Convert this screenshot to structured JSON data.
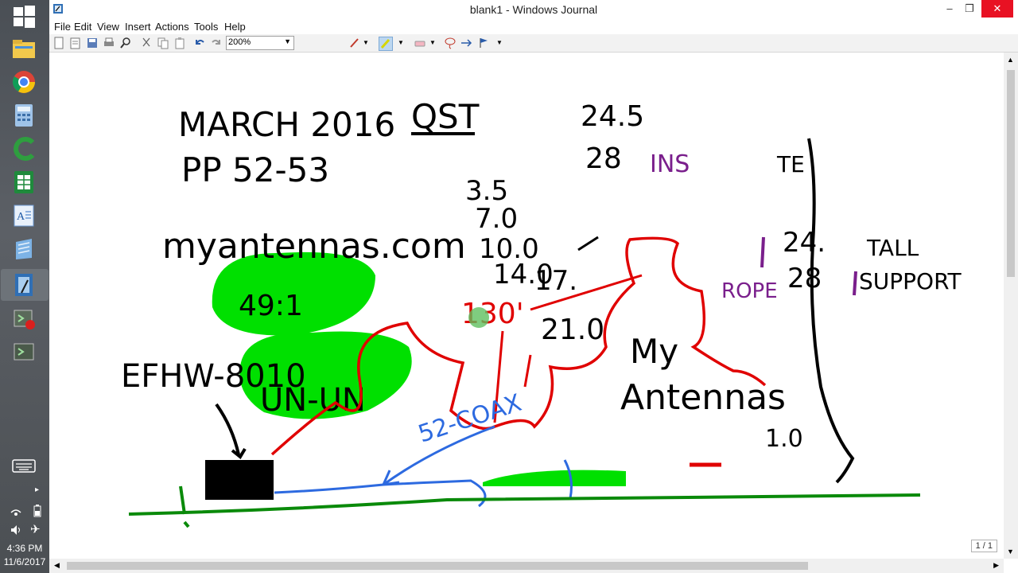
{
  "window": {
    "title": "blank1 - Windows Journal",
    "minimize": "–",
    "maximize": "❐",
    "close": "✕"
  },
  "menu": [
    "File",
    "Edit",
    "View",
    "Insert",
    "Actions",
    "Tools",
    "Help"
  ],
  "toolbar": {
    "zoom": "200%"
  },
  "taskbar": {
    "time": "4:36 PM",
    "date": "11/6/2017"
  },
  "page_indicator": "1 / 1",
  "ink_text": {
    "title_line1": "MARCH 2016",
    "title_qst": "QST",
    "title_line2": "PP  52-53",
    "site": "myantennas.com",
    "efhw": "EFHW-8010",
    "unun": "UN-UN",
    "ratio": "49:1",
    "length": "130'",
    "coax": "52-COAX",
    "freq_list": [
      "3.5",
      "7.0",
      "10.0",
      "14.0",
      "17.",
      "21.0",
      "24.5",
      "28"
    ],
    "freq_right": [
      "24.",
      "28"
    ],
    "my": "My",
    "antennas": "Antennas",
    "tall": "TALL",
    "support": "SUPPORT",
    "rope": "ROPE",
    "ins": "INS",
    "bottom_value": "1.0",
    "tree_top": "TE"
  }
}
